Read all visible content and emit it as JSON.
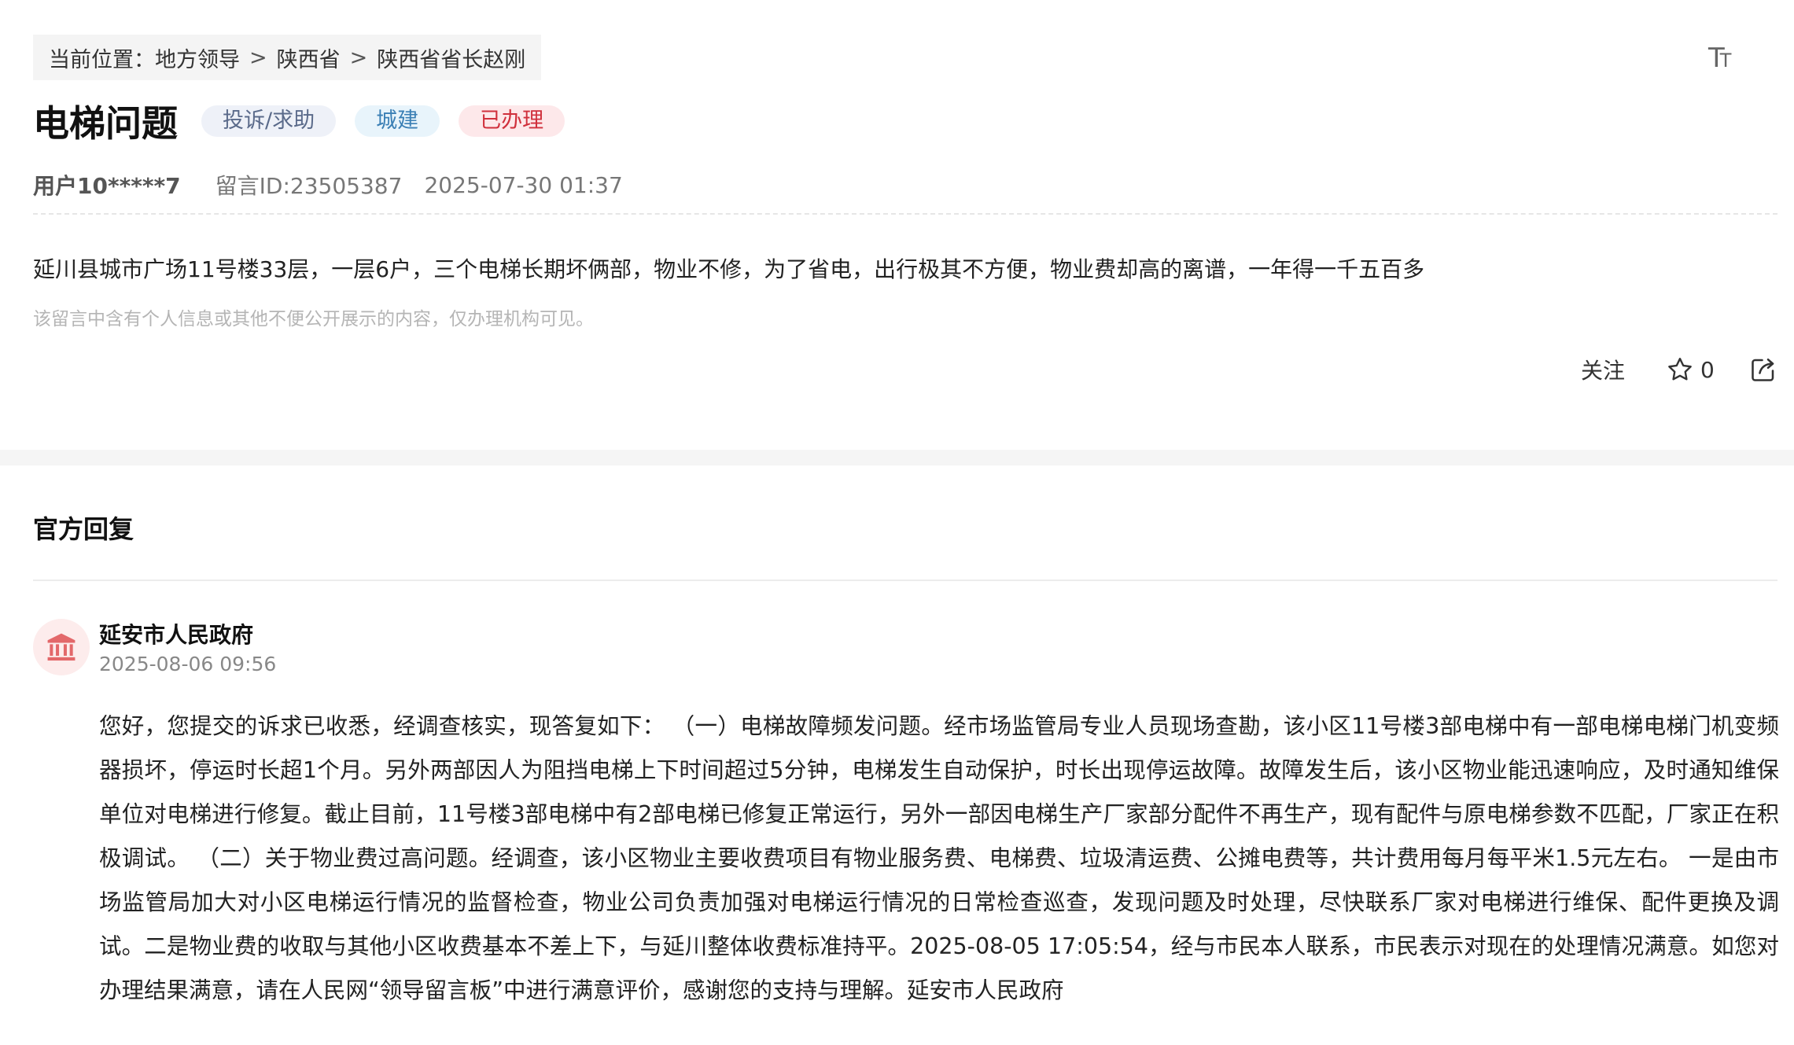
{
  "breadcrumb": {
    "prefix": "当前位置：",
    "items": [
      "地方领导",
      "陕西省",
      "陕西省省长赵刚"
    ],
    "separator": ">"
  },
  "font_size_control": {
    "big": "T",
    "small": "T"
  },
  "message": {
    "title": "电梯问题",
    "tags": {
      "type": "投诉/求助",
      "domain": "城建",
      "status": "已办理"
    },
    "user": "用户10*****7",
    "id_label": "留言ID:23505387",
    "time": "2025-07-30 01:37",
    "content": "延川县城市广场11号楼33层，一层6户，三个电梯长期坏俩部，物业不修，为了省电，出行极其不方便，物业费却高的离谱，一年得一千五百多",
    "privacy_note": "该留言中含有个人信息或其他不便公开展示的内容，仅办理机构可见。"
  },
  "actions": {
    "follow_label": "关注",
    "star_count": "0"
  },
  "colors": {
    "status_red": "#d0303c",
    "domain_blue": "#3a7fb5",
    "avatar_red": "#e3686a"
  },
  "reply": {
    "section_title": "官方回复",
    "org_name": "延安市人民政府",
    "time": "2025-08-06 09:56",
    "text": "您好，您提交的诉求已收悉，经调查核实，现答复如下：  （一）电梯故障频发问题。经市场监管局专业人员现场查勘，该小区11号楼3部电梯中有一部电梯电梯门机变频器损坏，停运时长超1个月。另外两部因人为阻挡电梯上下时间超过5分钟，电梯发生自动保护，时长出现停运故障。故障发生后，该小区物业能迅速响应，及时通知维保单位对电梯进行修复。截止目前，11号楼3部电梯中有2部电梯已修复正常运行，另外一部因电梯生产厂家部分配件不再生产，现有配件与原电梯参数不匹配，厂家正在积极调试。 （二）关于物业费过高问题。经调查，该小区物业主要收费项目有物业服务费、电梯费、垃圾清运费、公摊电费等，共计费用每月每平米1.5元左右。 一是由市场监管局加大对小区电梯运行情况的监督检查，物业公司负责加强对电梯运行情况的日常检查巡查，发现问题及时处理，尽快联系厂家对电梯进行维保、配件更换及调试。二是物业费的收取与其他小区收费基本不差上下，与延川整体收费标准持平。2025-08-05 17:05:54，经与市民本人联系，市民表示对现在的处理情况满意。如您对办理结果满意，请在人民网“领导留言板”中进行满意评价，感谢您的支持与理解。延安市人民政府"
  }
}
